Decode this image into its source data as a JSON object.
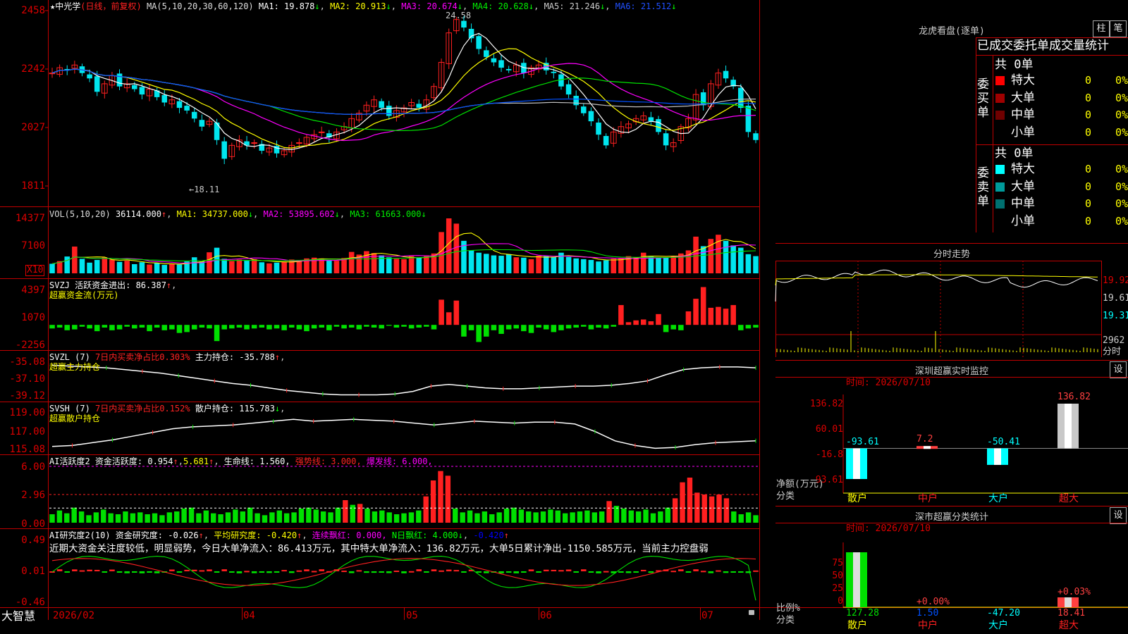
{
  "app": {
    "name": "大智慧"
  },
  "stock": {
    "star": "★",
    "name": "中光学",
    "period": "(日线，前复权)",
    "high_label": "24.58",
    "low_label": "←18.11"
  },
  "colors": {
    "up": "#ff2020",
    "down": "#00e5ee",
    "ma1": "#ffffff",
    "ma2": "#ffff00",
    "ma3": "#ff00ff",
    "ma4": "#00e000",
    "ma5": "#c0c0c0",
    "ma6": "#0050ff",
    "grid": "#c00000",
    "axis": "#d00000"
  },
  "ma_bar": {
    "ma": "MA(5,10,20,30,60,120)",
    "ma1": "MA1: 19.878",
    "ma2": "MA2: 20.913",
    "ma3": "MA3: 20.674",
    "ma4": "MA4: 20.628",
    "ma5": "MA5: 21.246",
    "ma6": "MA6: 21.512",
    "arrow": "↓"
  },
  "price_axis": [
    "2458",
    "2242",
    "2027",
    "1811"
  ],
  "vol_bar": {
    "title": "VOL(5,10,20)",
    "value": "36114.000",
    "ma1": "MA1: 34737.000",
    "ma2": "MA2: 53895.602",
    "ma3": "MA3: 61663.000",
    "up": "↑",
    "down": "↓"
  },
  "vol_axis": [
    "14377",
    "7100"
  ],
  "vol_unit": "X10",
  "svzj": {
    "title": "SVZJ  活跃资金进出: 86.387",
    "sub": "超赢资金流(万元)",
    "axis": [
      "4397",
      "1070",
      "-2256"
    ]
  },
  "svzl": {
    "title": "SVZL (7)",
    "pct": "7日内买卖净占比0.303%",
    "val": "主力持仓: -35.788",
    "sub": "超赢主力持仓",
    "axis": [
      "-35.08",
      "-37.10",
      "-39.12"
    ]
  },
  "svsh": {
    "title": "SVSH (7)",
    "pct": "7日内买卖净占比0.152%",
    "val": "散户持仓: 115.783",
    "sub": "超赢散户持仓",
    "axis": [
      "119.00",
      "117.00",
      "115.08"
    ]
  },
  "ai_active": {
    "title": "AI活跃度2 资金活跃度: 0.954",
    "v2": "5.681",
    "life": "生命线: 1.560,",
    "strong": "强势线: 3.000,",
    "burst": "爆发线: 6.000,",
    "axis": [
      "6.00",
      "2.96",
      "0.00"
    ]
  },
  "ai_research": {
    "title": "AI研究度2(10) 资金研究度: -0.026",
    "avg": "平均研究度: -0.420",
    "red": "连续飘红: 0.000,",
    "nred": "N日飘红: 4.000",
    "last": "-0.420",
    "axis": [
      "0.49",
      "0.01",
      "-0.46"
    ],
    "commentary": "近期大资金关注度较低，明显弱势，今日大单净流入：86.413万元，其中特大单净流入：136.82万元，大单5日累计净出-1150.585万元，当前主力控盘弱"
  },
  "dates": [
    "2026/02",
    "04",
    "05",
    "06",
    "07"
  ],
  "dragon": {
    "title": "龙虎看盘(逐单)",
    "btn1": "柱",
    "btn2": "笔",
    "header": "已成交委托单成交量统计",
    "buy_label": "委买单",
    "sell_label": "委卖单",
    "buy_total": "共 0单",
    "sell_total": "共 0单",
    "buy_rows": [
      {
        "name": "特大",
        "val": "0",
        "pct": "0%",
        "color": "#ff0000"
      },
      {
        "name": "大单",
        "val": "0",
        "pct": "0%",
        "color": "#a00000"
      },
      {
        "name": "中单",
        "val": "0",
        "pct": "0%",
        "color": "#700000"
      },
      {
        "name": "小单",
        "val": "0",
        "pct": "0%",
        "color": ""
      }
    ],
    "sell_rows": [
      {
        "name": "特大",
        "val": "0",
        "pct": "0%",
        "color": "#00ffff"
      },
      {
        "name": "大单",
        "val": "0",
        "pct": "0%",
        "color": "#009a9a"
      },
      {
        "name": "中单",
        "val": "0",
        "pct": "0%",
        "color": "#007070"
      },
      {
        "name": "小单",
        "val": "0",
        "pct": "0%",
        "color": ""
      }
    ]
  },
  "intraday": {
    "title": "分时走势",
    "axis": [
      "19.92",
      "19.61",
      "19.31"
    ],
    "vol_label": "2962",
    "vol_unit": "分时"
  },
  "sz_monitor": {
    "title": "深圳超赢实时监控",
    "gear": "设",
    "time": "时间: 2026/07/10",
    "axis": [
      "136.82",
      "60.01",
      "-16.8",
      "-93.61"
    ],
    "ylabel": "净额(万元)",
    "xlabel": "分类",
    "values_label": [
      "-93.61",
      "7.2",
      "-50.41",
      "136.82"
    ]
  },
  "sz_stats": {
    "title": "深市超赢分类统计",
    "gear": "设",
    "time": "时间: 2026/07/10",
    "axis": [
      "75",
      "50",
      "25",
      "0"
    ],
    "ylabel": "比例%",
    "xlabel": "分类",
    "top_labels": [
      "+0.00%",
      "+0.03%"
    ],
    "bottom_values": [
      "127.28",
      "1.50",
      "-47.20",
      "18.41"
    ]
  },
  "categories": [
    "散户",
    "中户",
    "大户",
    "超大"
  ],
  "chart_data": [
    {
      "type": "candlestick",
      "title": "中光学 (日线，前复权)",
      "ylim": [
        18.11,
        24.58
      ],
      "y_ticks": [
        "2458",
        "2242",
        "2027",
        "1811"
      ],
      "x_ticks": [
        "2026/02",
        "04",
        "05",
        "06",
        "07"
      ],
      "annotations": [
        "24.58",
        "←18.11"
      ],
      "close": [
        22.3,
        22.5,
        22.4,
        22.6,
        22.3,
        22.1,
        21.6,
        21.9,
        22.2,
        21.8,
        21.9,
        21.7,
        21.5,
        21.7,
        21.4,
        21.2,
        21.3,
        21.0,
        20.9,
        20.6,
        20.3,
        20.5,
        19.8,
        19.1,
        19.6,
        19.8,
        19.6,
        19.7,
        19.4,
        19.5,
        19.3,
        19.4,
        19.6,
        19.7,
        19.9,
        20.0,
        20.1,
        19.9,
        20.1,
        20.3,
        20.6,
        20.8,
        21.1,
        21.3,
        21.0,
        20.7,
        20.9,
        21.0,
        21.2,
        21.0,
        21.3,
        21.8,
        22.7,
        23.8,
        24.3,
        24.0,
        23.6,
        23.2,
        22.9,
        22.7,
        22.5,
        22.4,
        22.6,
        22.3,
        22.5,
        22.6,
        22.4,
        22.3,
        21.8,
        21.5,
        21.1,
        20.8,
        20.5,
        20.0,
        19.6,
        20.1,
        20.3,
        20.4,
        20.6,
        20.7,
        20.5,
        20.1,
        19.6,
        19.7,
        20.3,
        20.6,
        21.5,
        21.1,
        21.9,
        22.3,
        22.1,
        21.8,
        21.0,
        20.1,
        19.8
      ],
      "series": [
        {
          "name": "MA1",
          "value": 19.878
        },
        {
          "name": "MA2",
          "value": 20.913
        },
        {
          "name": "MA3",
          "value": 20.674
        },
        {
          "name": "MA4",
          "value": 20.628
        },
        {
          "name": "MA5",
          "value": 21.246
        },
        {
          "name": "MA6",
          "value": 21.512
        }
      ]
    },
    {
      "type": "bar",
      "title": "VOL(5,10,20)",
      "y_ticks": [
        "14377",
        "7100"
      ],
      "unit": "X10",
      "ylim": [
        0,
        14377
      ],
      "values": [
        2500,
        3200,
        4400,
        7000,
        3800,
        2800,
        3500,
        4200,
        3600,
        3000,
        3300,
        2400,
        2900,
        2300,
        2700,
        2200,
        2400,
        2300,
        3100,
        4200,
        3100,
        5500,
        6700,
        3800,
        3200,
        3600,
        3300,
        3700,
        2900,
        2600,
        2800,
        3000,
        3600,
        3500,
        3900,
        4100,
        3900,
        3500,
        3300,
        4000,
        5600,
        4900,
        5800,
        5300,
        4700,
        4200,
        3800,
        3700,
        4500,
        4100,
        4700,
        5200,
        10800,
        14377,
        13000,
        8500,
        6000,
        5400,
        5100,
        4700,
        4600,
        5000,
        4200,
        4100,
        3700,
        4600,
        4500,
        4300,
        5400,
        4300,
        3900,
        3700,
        3500,
        3100,
        3400,
        3800,
        4000,
        4500,
        4200,
        5400,
        4400,
        4000,
        4200,
        4500,
        5200,
        6000,
        9600,
        7100,
        9000,
        10100,
        8500,
        7300,
        6700,
        5000,
        4500
      ],
      "series": [
        {
          "name": "MA1",
          "value": 34737
        },
        {
          "name": "MA2",
          "value": 53895.602
        },
        {
          "name": "MA3",
          "value": 61663
        }
      ]
    },
    {
      "type": "bar",
      "title": "超赢资金流(万元)",
      "ylim": [
        -2256,
        4397
      ],
      "values": [
        -400,
        -300,
        -600,
        -500,
        -200,
        -400,
        -700,
        -300,
        -600,
        -500,
        -200,
        -400,
        -300,
        -700,
        -300,
        -600,
        -500,
        -900,
        -800,
        -500,
        -300,
        -400,
        -1800,
        -500,
        -400,
        -300,
        -500,
        -400,
        -300,
        -500,
        -400,
        -600,
        -300,
        -500,
        -700,
        -400,
        -300,
        -600,
        -200,
        -400,
        -300,
        -500,
        -200,
        -300,
        -400,
        -100,
        -300,
        -200,
        -400,
        -300,
        -200,
        -500,
        2800,
        1400,
        2700,
        -1300,
        -600,
        -1900,
        -1300,
        -600,
        -1000,
        -500,
        -400,
        -700,
        -900,
        -300,
        -500,
        -800,
        -600,
        -400,
        -300,
        -200,
        -500,
        -300,
        -400,
        -200,
        2200,
        300,
        500,
        600,
        400,
        1200,
        -800,
        -500,
        -600,
        1500,
        2900,
        4200,
        1900,
        2000,
        1800,
        2200,
        -600,
        -400,
        -300
      ],
      "y_ticks": [
        "4397",
        "1070",
        "-2256"
      ]
    },
    {
      "type": "line",
      "title": "超赢主力持仓",
      "ylim": [
        -39.12,
        -35.08
      ],
      "values": [
        -35.6,
        -35.7,
        -35.8,
        -35.9,
        -36.1,
        -36.3,
        -36.5,
        -36.8,
        -37.1,
        -37.4,
        -37.7,
        -37.9,
        -38.2,
        -38.5,
        -38.7,
        -38.9,
        -39.0,
        -39.0,
        -39.0,
        -38.9,
        -38.6,
        -38.0,
        -37.8,
        -38.0,
        -38.2,
        -38.3,
        -38.3,
        -38.2,
        -38.1,
        -38.0,
        -38.0,
        -37.9,
        -37.7,
        -37.4,
        -36.7,
        -36.1,
        -35.9,
        -35.8,
        -35.8,
        -35.9
      ],
      "y_ticks": [
        "-35.08",
        "-37.10",
        "-39.12"
      ]
    },
    {
      "type": "line",
      "title": "超赢散户持仓",
      "ylim": [
        115.08,
        119.0
      ],
      "values": [
        115.4,
        115.5,
        115.8,
        116.1,
        116.5,
        116.9,
        117.3,
        117.5,
        117.6,
        117.7,
        117.9,
        118.1,
        118.3,
        118.1,
        118.2,
        118.3,
        118.2,
        118.1,
        117.9,
        117.7,
        117.9,
        118.1,
        118.0,
        117.9,
        118.0,
        118.0,
        117.8,
        117.0,
        116.0,
        115.5,
        115.2,
        115.3,
        115.6,
        115.8,
        115.9,
        116.0
      ],
      "y_ticks": [
        "119.00",
        "117.00",
        "115.08"
      ]
    },
    {
      "type": "bar",
      "title": "AI活跃度2",
      "ylim": [
        0,
        6.0
      ],
      "y_ticks": [
        "6.00",
        "2.96",
        "0.00"
      ],
      "reference_lines": [
        {
          "name": "生命线",
          "value": 1.56
        },
        {
          "name": "强势线",
          "value": 3.0
        },
        {
          "name": "爆发线",
          "value": 6.0
        }
      ],
      "values": [
        0.9,
        1.3,
        1.0,
        1.6,
        1.2,
        0.8,
        1.1,
        1.4,
        1.0,
        0.9,
        1.2,
        1.0,
        1.1,
        0.9,
        1.0,
        0.8,
        1.1,
        1.2,
        1.5,
        1.6,
        1.0,
        1.3,
        1.0,
        0.9,
        1.1,
        1.4,
        1.2,
        1.6,
        1.0,
        0.8,
        1.1,
        1.3,
        1.0,
        1.1,
        1.5,
        1.6,
        1.4,
        1.2,
        1.1,
        1.6,
        2.4,
        1.9,
        2.0,
        1.5,
        1.2,
        1.3,
        1.1,
        0.9,
        1.0,
        1.1,
        1.3,
        2.8,
        4.5,
        5.5,
        5.0,
        1.5,
        1.1,
        1.3,
        1.0,
        1.2,
        0.9,
        1.1,
        1.5,
        1.6,
        1.4,
        1.2,
        1.1,
        1.2,
        1.4,
        1.3,
        1.0,
        1.1,
        1.2,
        1.3,
        1.1,
        1.2,
        2.3,
        1.8,
        1.5,
        1.3,
        1.2,
        1.4,
        1.0,
        1.2,
        1.6,
        2.6,
        4.3,
        4.8,
        3.2,
        3.0,
        2.8,
        3.0,
        2.6,
        1.2,
        0.9,
        1.1,
        0.8
      ],
      "last_value": 0.954
    },
    {
      "type": "bar",
      "title": "AI研究度2(10)",
      "ylim": [
        -0.46,
        0.49
      ],
      "y_ticks": [
        "0.49",
        "0.01",
        "-0.46"
      ],
      "last_value": -0.026
    }
  ]
}
